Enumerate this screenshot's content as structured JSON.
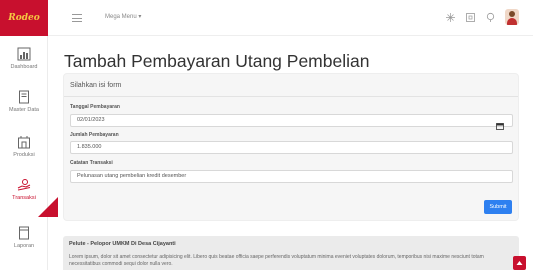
{
  "brand": {
    "logo_text": "Rodeo"
  },
  "topbar": {
    "mega_menu_label": "Mega Menu"
  },
  "sidebar": {
    "items": [
      {
        "label": "Dashboard"
      },
      {
        "label": "Master Data"
      },
      {
        "label": "Produksi"
      },
      {
        "label": "Transaksi"
      },
      {
        "label": "Laporan"
      }
    ]
  },
  "page": {
    "title": "Tambah Pembayaran Utang Pembelian"
  },
  "form": {
    "heading": "Silahkan isi form",
    "fields": [
      {
        "label": "Tanggal Pembayaran",
        "value": "02/01/2023"
      },
      {
        "label": "Jumlah Pembayaran",
        "value": "1.835.000"
      },
      {
        "label": "Catatan Transaksi",
        "value": "Pelunasan utang pembelian kredit desember"
      }
    ],
    "submit_label": "Submit"
  },
  "footer": {
    "title": "Pelute - Pelopor UMKM Di Desa Cijayanti",
    "text": "Lorem ipsum, dolor sit amet consectetur adipisicing elit. Libero quis beatae officia saepe perferendis voluptatum minima eveniet voluptates dolorum, temporibus nisi maxime nesciunt totam necessitatibus commodi sequi dolor nulla vero."
  },
  "colors": {
    "brand": "#c8102e",
    "primary_button": "#2e80f0"
  }
}
